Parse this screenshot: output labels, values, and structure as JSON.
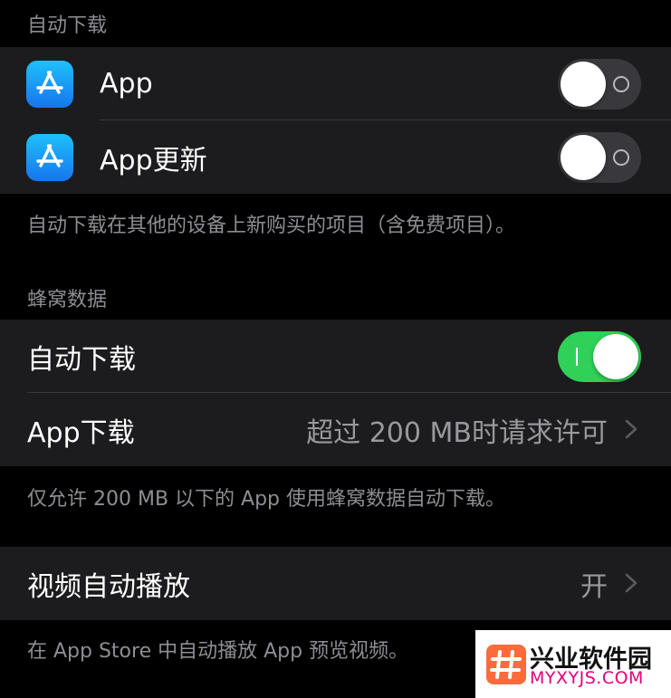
{
  "auto_download_section": {
    "header": "自动下载",
    "rows": [
      {
        "label": "App",
        "icon": "app-store-icon",
        "toggle_on": false
      },
      {
        "label": "App更新",
        "icon": "app-store-icon",
        "toggle_on": false
      }
    ],
    "footer": "自动下载在其他的设备上新购买的项目（含免费项目）。"
  },
  "cellular_section": {
    "header": "蜂窝数据",
    "auto_download_label": "自动下载",
    "auto_download_on": true,
    "app_download_label": "App下载",
    "app_download_value": "超过 200 MB时请求许可",
    "footer": "仅允许 200 MB 以下的 App 使用蜂窝数据自动下载。"
  },
  "video_section": {
    "autoplay_label": "视频自动播放",
    "autoplay_value": "开",
    "footer": "在 App Store 中自动播放 App 预览视频。"
  },
  "watermark": {
    "title": "兴业软件园",
    "url": "MYXYJS.COM"
  },
  "colors": {
    "background": "#000000",
    "group_background": "#1c1c1e",
    "separator": "#38383a",
    "secondary_text": "#8d8d93",
    "toggle_on": "#30d158",
    "toggle_off": "#39393d",
    "icon_gradient_top": "#1ec1fa",
    "icon_gradient_bottom": "#1775ee",
    "watermark_accent": "#e6007e"
  }
}
